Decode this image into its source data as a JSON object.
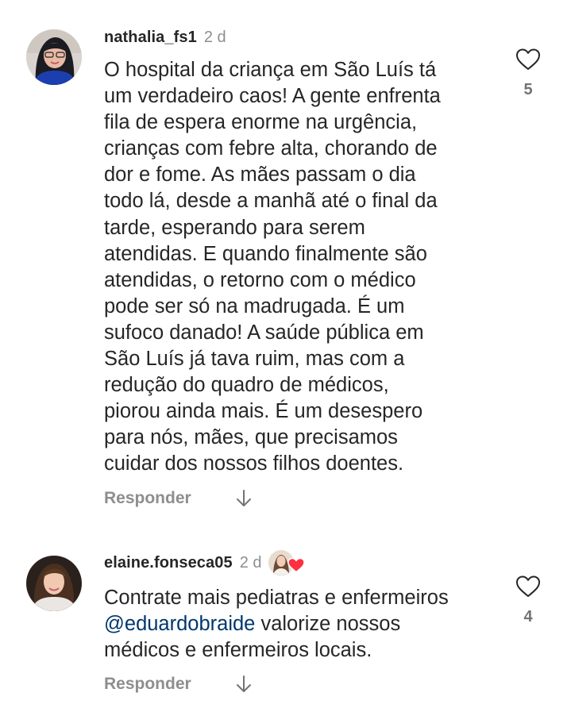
{
  "comments": [
    {
      "username": "nathalia_fs1",
      "time": "2 d",
      "text_lines": [
        "O hospital da criança em São Luís tá",
        "um verdadeiro caos! A gente enfrenta",
        "fila de espera enorme na urgência,",
        "crianças com febre alta, chorando de",
        "dor e fome. As mães passam o dia",
        "todo lá, desde a manhã até o final da",
        "tarde, esperando para serem",
        "atendidas. E quando finalmente são",
        "atendidas, o retorno com o médico",
        "pode ser só na madrugada. É um",
        "sufoco danado! A saúde pública em",
        "São Luís já tava ruim, mas com a",
        "redução do quadro de médicos,",
        "piorou ainda mais. É um desespero",
        "para nós, mães, que precisamos",
        "cuidar dos nossos filhos doentes."
      ],
      "reply_label": "Responder",
      "like_count": "5"
    },
    {
      "username": "elaine.fonseca05",
      "time": "2 d",
      "text_line1": "Contrate mais pediatras e enfermeiros",
      "mention": "@eduardobraide",
      "text_line2_rest": " valorize nossos",
      "text_line3": "médicos e enfermeiros locais.",
      "reply_label": "Responder",
      "like_count": "4"
    }
  ],
  "icons": {
    "like": "heart-outline-icon",
    "expand": "arrow-down-icon",
    "creator_like": "red-heart-icon"
  },
  "colors": {
    "text": "#262626",
    "secondary": "#8e8e8e",
    "mention": "#00376b",
    "heart_red": "#ff3040"
  }
}
